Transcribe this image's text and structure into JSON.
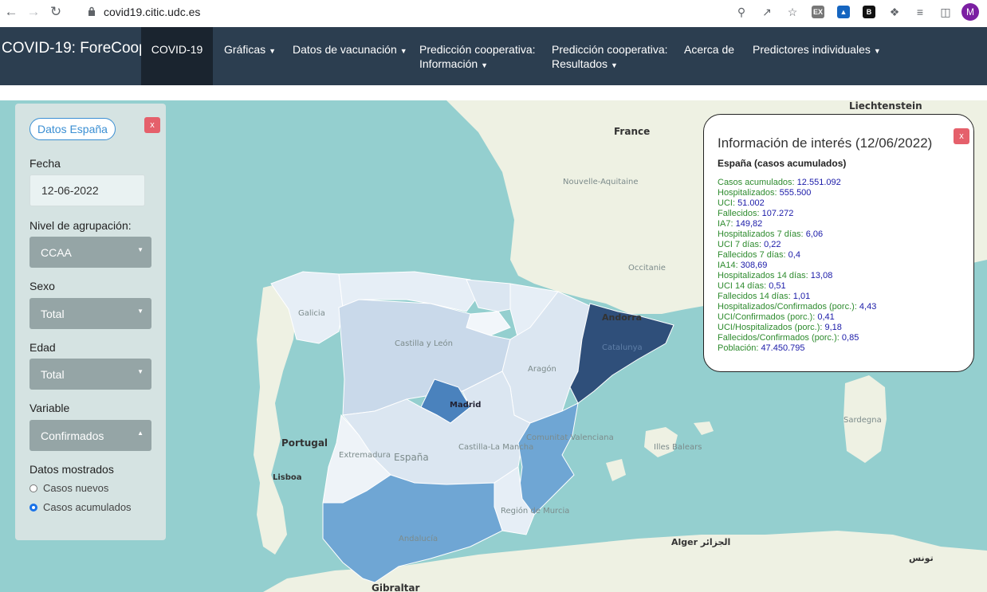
{
  "browser": {
    "url": "covid19.citic.udc.es",
    "avatar_letter": "M"
  },
  "nav": {
    "brand": "COVID-19: ForeCoop",
    "items": [
      {
        "label": "COVID-19",
        "active": true
      },
      {
        "label": "Gráficas",
        "caret": true
      },
      {
        "label": "Datos de vacunación",
        "caret": true
      },
      {
        "label_line1": "Predicción cooperativa:",
        "label_line2": "Información",
        "caret": true
      },
      {
        "label_line1": "Predicción cooperativa:",
        "label_line2": "Resultados",
        "caret": true
      },
      {
        "label": "Acerca de"
      },
      {
        "label": "Predictores individuales",
        "caret": true
      }
    ]
  },
  "panel": {
    "spain_button": "Datos España",
    "close_label": "x",
    "fecha_label": "Fecha",
    "fecha_value": "12-06-2022",
    "agrupacion_label": "Nivel de agrupación:",
    "agrupacion_value": "CCAA",
    "sexo_label": "Sexo",
    "sexo_value": "Total",
    "edad_label": "Edad",
    "edad_value": "Total",
    "variable_label": "Variable",
    "variable_value": "Confirmados",
    "datos_label": "Datos mostrados",
    "radio_nuevos": "Casos nuevos",
    "radio_acumulados": "Casos acumulados",
    "selected_radio": "Casos acumulados"
  },
  "map_labels": {
    "france": "France",
    "portugal": "Portugal",
    "lisboa": "Lisboa",
    "madrid": "Madrid",
    "espana": "España",
    "andorra": "Andorra",
    "gibraltar": "Gibraltar",
    "alger": "Alger الجزائر",
    "liechtenstein": "Liechtenstein",
    "sardegna": "Sardegna",
    "tunis": "تونس",
    "galicia": "Galicia",
    "castilla": "Castilla y León",
    "aragon": "Aragón",
    "catalunya": "Catalunya",
    "extremadura": "Extremadura",
    "castilla_mancha": "Castilla-La Mancha",
    "valenciana": "Comunitat Valenciana",
    "andalucia": "Andalucía",
    "murcia": "Región de Murcia",
    "baleares": "Illes Balears",
    "aquitaine": "Nouvelle-Aquitaine",
    "occitanie": "Occitanie"
  },
  "info": {
    "title": "Información de interés (12/06/2022)",
    "subtitle": "España (casos acumulados)",
    "close_label": "x",
    "rows": [
      {
        "label": "Casos acumulados:",
        "value": "12.551.092"
      },
      {
        "label": "Hospitalizados:",
        "value": "555.500"
      },
      {
        "label": "UCI:",
        "value": "51.002"
      },
      {
        "label": "Fallecidos:",
        "value": "107.272"
      },
      {
        "label": "IA7:",
        "value": "149,82"
      },
      {
        "label": "Hospitalizados 7 días:",
        "value": "6,06"
      },
      {
        "label": "UCI 7 días:",
        "value": "0,22"
      },
      {
        "label": "Fallecidos 7 días:",
        "value": "0,4"
      },
      {
        "label": "IA14:",
        "value": "308,69"
      },
      {
        "label": "Hospitalizados 14 días:",
        "value": "13,08"
      },
      {
        "label": "UCI 14 días:",
        "value": "0,51"
      },
      {
        "label": "Fallecidos 14 días:",
        "value": "1,01"
      },
      {
        "label": "Hospitalizados/Confirmados (porc.):",
        "value": "4,43"
      },
      {
        "label": "UCI/Confirmados (porc.):",
        "value": "0,41"
      },
      {
        "label": "UCI/Hospitalizados (porc.):",
        "value": "9,18"
      },
      {
        "label": "Fallecidos/Confirmados (porc.):",
        "value": "0,85"
      },
      {
        "label": "Población:",
        "value": "47.450.795"
      }
    ]
  },
  "colors": {
    "navbar": "#2c3e50",
    "sea": "#94cfcf",
    "land": "#eef1e3",
    "choropleth_light": "#e6eef6",
    "choropleth_mid": "#c9d9ea",
    "choropleth_blue": "#6fa6d4",
    "choropleth_dark": "#2f4f7a"
  }
}
